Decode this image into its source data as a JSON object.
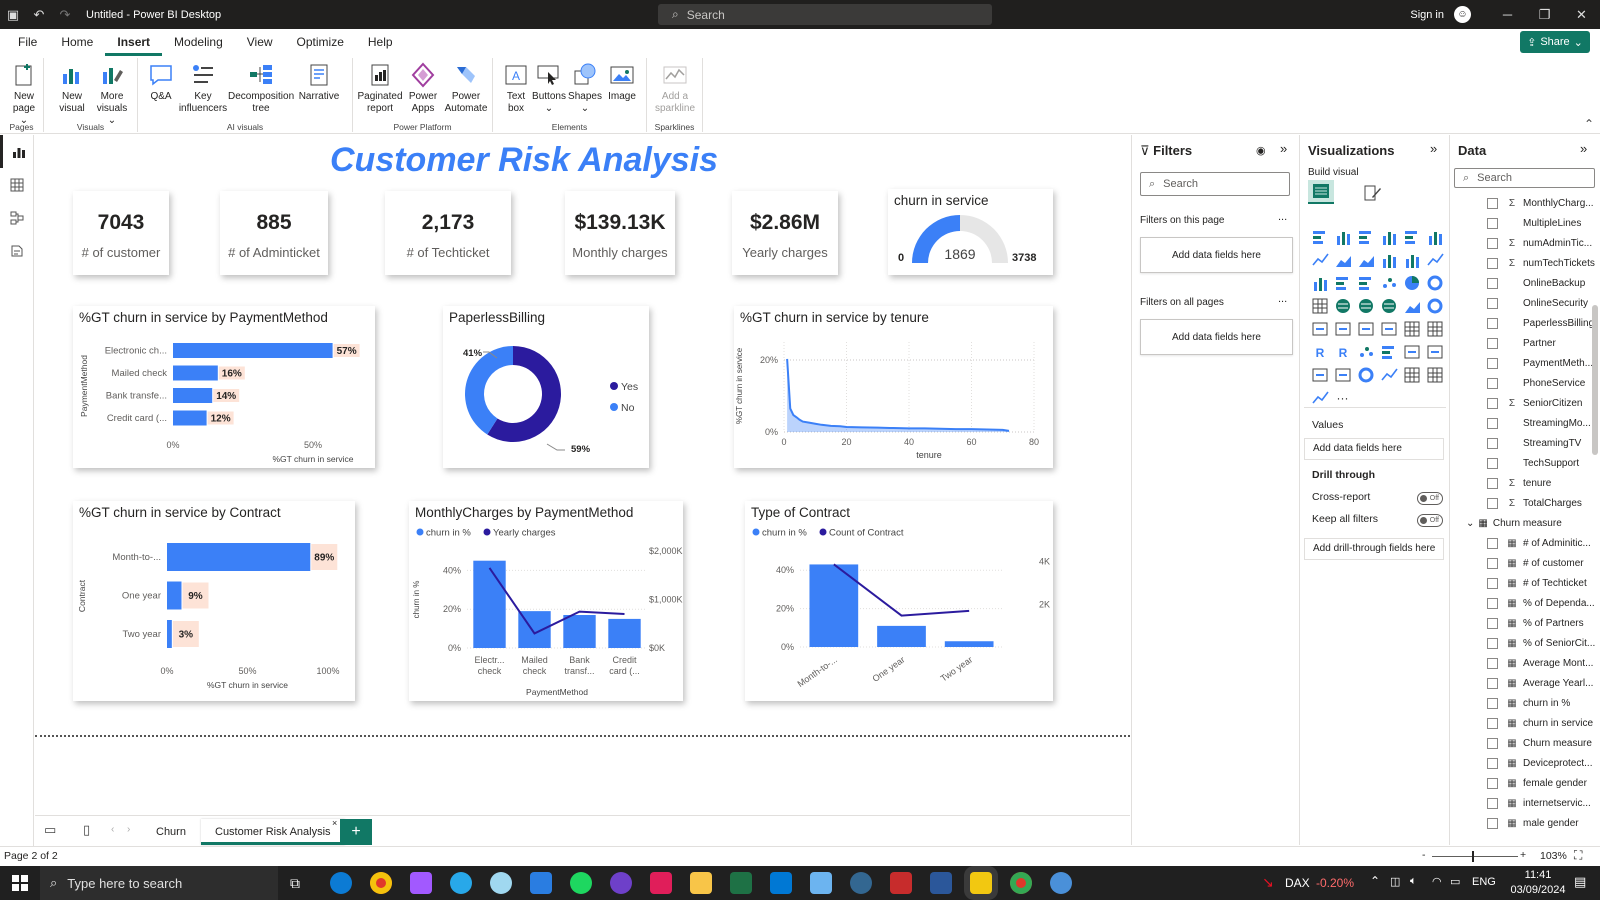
{
  "window": {
    "title": "Untitled - Power BI Desktop",
    "search_placeholder": "Search",
    "sign_in": "Sign in"
  },
  "menu": {
    "items": [
      "File",
      "Home",
      "Insert",
      "Modeling",
      "View",
      "Optimize",
      "Help"
    ],
    "active": "Insert",
    "share": "Share"
  },
  "ribbon": {
    "groups": [
      {
        "label": "Pages",
        "buttons": [
          {
            "label": "New page",
            "sub": "⌄"
          }
        ]
      },
      {
        "label": "Visuals",
        "buttons": [
          {
            "label": "New visual"
          },
          {
            "label": "More visuals",
            "sub": "⌄"
          }
        ]
      },
      {
        "label": "AI visuals",
        "buttons": [
          {
            "label": "Q&A"
          },
          {
            "label": "Key influencers"
          },
          {
            "label": "Decomposition tree"
          },
          {
            "label": "Narrative"
          }
        ]
      },
      {
        "label": "Power Platform",
        "buttons": [
          {
            "label": "Paginated report"
          },
          {
            "label": "Power Apps"
          },
          {
            "label": "Power Automate"
          }
        ]
      },
      {
        "label": "Elements",
        "buttons": [
          {
            "label": "Text box"
          },
          {
            "label": "Buttons",
            "sub": "⌄"
          },
          {
            "label": "Shapes",
            "sub": "⌄"
          },
          {
            "label": "Image"
          }
        ]
      },
      {
        "label": "Sparklines",
        "buttons": [
          {
            "label": "Add a sparkline"
          }
        ]
      }
    ]
  },
  "report": {
    "title": "Customer Risk Analysis",
    "kpis": [
      {
        "value": "7043",
        "label": "# of customer"
      },
      {
        "value": "885",
        "label": "# of Adminticket"
      },
      {
        "value": "2,173",
        "label": "# of Techticket"
      },
      {
        "value": "$139.13K",
        "label": "Monthly charges"
      },
      {
        "value": "$2.86M",
        "label": "Yearly charges"
      }
    ],
    "gauge": {
      "title": "churn in service",
      "min_label": "0",
      "value_label": "1869",
      "max_label": "3738"
    },
    "visual_titles": {
      "payment": "%GT churn in service by PaymentMethod",
      "paperless": "PaperlessBilling",
      "tenure": "%GT churn in service by tenure",
      "contract": "%GT churn in service by Contract",
      "monthly": "MonthlyCharges by PaymentMethod",
      "typecontract": "Type of Contract"
    }
  },
  "chart_data": [
    {
      "type": "gauge",
      "title": "churn in service",
      "value": 1869,
      "min": 0,
      "max": 3738
    },
    {
      "type": "bar",
      "title": "%GT churn in service by PaymentMethod",
      "categories": [
        "Electronic ch...",
        "Mailed check",
        "Bank transfe...",
        "Credit card (..."
      ],
      "values": [
        57,
        16,
        14,
        12
      ],
      "data_labels": [
        "57%",
        "16%",
        "14%",
        "12%"
      ],
      "xlabel": "%GT churn in service",
      "ylabel": "PaymentMethod",
      "x_ticks": [
        "0%",
        "50%"
      ],
      "xlim": [
        0,
        100
      ]
    },
    {
      "type": "pie",
      "title": "PaperlessBilling",
      "categories": [
        "Yes",
        "No"
      ],
      "values": [
        59,
        41
      ],
      "data_labels": [
        "59%",
        "41%"
      ],
      "colors": [
        "#2b1b9e",
        "#3b80f7"
      ]
    },
    {
      "type": "area",
      "title": "%GT churn in service by tenure",
      "xlabel": "tenure",
      "ylabel": "%GT churn in service",
      "x_ticks": [
        "0",
        "20",
        "40",
        "60",
        "80"
      ],
      "y_ticks": [
        "0%",
        "20%"
      ],
      "xlim": [
        0,
        80
      ],
      "ylim": [
        0,
        25
      ],
      "x": [
        1,
        2,
        3,
        4,
        5,
        6,
        8,
        10,
        12,
        15,
        18,
        20,
        25,
        30,
        35,
        40,
        45,
        50,
        55,
        60,
        65,
        70,
        72
      ],
      "y": [
        20.3,
        6.5,
        4.7,
        4.1,
        3.4,
        2.9,
        2.6,
        2.3,
        2.0,
        1.7,
        1.6,
        1.4,
        1.3,
        1.2,
        1.1,
        1.0,
        1.0,
        0.9,
        0.8,
        0.8,
        0.7,
        0.6,
        0.3
      ]
    },
    {
      "type": "bar",
      "title": "%GT churn in service by Contract",
      "categories": [
        "Month-to-...",
        "One year",
        "Two year"
      ],
      "values": [
        89,
        9,
        3
      ],
      "data_labels": [
        "89%",
        "9%",
        "3%"
      ],
      "xlabel": "%GT churn in service",
      "ylabel": "Contract",
      "x_ticks": [
        "0%",
        "50%",
        "100%"
      ],
      "xlim": [
        0,
        100
      ]
    },
    {
      "type": "bar",
      "title": "MonthlyCharges by PaymentMethod",
      "categories": [
        "Electr... check",
        "Mailed check",
        "Bank transf...",
        "Credit card (..."
      ],
      "xlabel": "PaymentMethod",
      "ylabel": "churn in %",
      "y_ticks": [
        "0%",
        "20%",
        "40%"
      ],
      "y2_ticks": [
        "$0K",
        "$1,000K",
        "$2,000K"
      ],
      "ylim": [
        0,
        50
      ],
      "y2lim": [
        0,
        2000
      ],
      "series": [
        {
          "name": "churn in %",
          "values": [
            45,
            19,
            17,
            15
          ],
          "color": "#3b80f7"
        },
        {
          "name": "Yearly charges",
          "values": [
            1650,
            300,
            750,
            700
          ],
          "color": "#2b1b9e"
        }
      ]
    },
    {
      "type": "bar",
      "title": "Type of Contract",
      "categories": [
        "Month-to-...",
        "One year",
        "Two year"
      ],
      "y_ticks": [
        "0%",
        "20%",
        "40%"
      ],
      "y2_ticks": [
        "2K",
        "4K"
      ],
      "ylim": [
        0,
        50
      ],
      "y2lim": [
        0,
        4500
      ],
      "series": [
        {
          "name": "churn in %",
          "values": [
            43,
            11,
            3
          ],
          "color": "#3b80f7"
        },
        {
          "name": "Count of Contract",
          "values": [
            3875,
            1473,
            1695
          ],
          "color": "#2b1b9e"
        }
      ]
    }
  ],
  "pages": {
    "tabs": [
      "Churn",
      "Customer Risk Analysis"
    ],
    "active": "Customer Risk Analysis",
    "add": "+"
  },
  "status": {
    "page": "Page 2 of 2",
    "zoom_minus": "-",
    "zoom_plus": "+",
    "zoom": "103%"
  },
  "filters": {
    "title": "Filters",
    "search_placeholder": "Search",
    "on_page": "Filters on this page",
    "on_all": "Filters on all pages",
    "add_fields": "Add data fields here",
    "more": "..."
  },
  "viz": {
    "title": "Visualizations",
    "build": "Build visual",
    "values": "Values",
    "add_fields": "Add data fields here",
    "drill": "Drill through",
    "cross_report": "Cross-report",
    "keep_filters": "Keep all filters",
    "toggle_off": "Off",
    "add_drill": "Add drill-through fields here",
    "more": "..."
  },
  "data": {
    "title": "Data",
    "search_placeholder": "Search",
    "fields": [
      {
        "name": "MonthlyCharg...",
        "icon": "Σ"
      },
      {
        "name": "MultipleLines",
        "icon": ""
      },
      {
        "name": "numAdminTic...",
        "icon": "Σ"
      },
      {
        "name": "numTechTickets",
        "icon": "Σ"
      },
      {
        "name": "OnlineBackup",
        "icon": ""
      },
      {
        "name": "OnlineSecurity",
        "icon": ""
      },
      {
        "name": "PaperlessBilling",
        "icon": ""
      },
      {
        "name": "Partner",
        "icon": ""
      },
      {
        "name": "PaymentMeth...",
        "icon": ""
      },
      {
        "name": "PhoneService",
        "icon": ""
      },
      {
        "name": "SeniorCitizen",
        "icon": "Σ"
      },
      {
        "name": "StreamingMo...",
        "icon": ""
      },
      {
        "name": "StreamingTV",
        "icon": ""
      },
      {
        "name": "TechSupport",
        "icon": ""
      },
      {
        "name": "tenure",
        "icon": "Σ"
      },
      {
        "name": "TotalCharges",
        "icon": "Σ"
      }
    ],
    "table": "Churn measure",
    "measures": [
      "# of Adminitic...",
      "# of customer",
      "# of Techticket",
      "% of Dependa...",
      "% of Partners",
      "% of SeniorCit...",
      "Average Mont...",
      "Average Yearl...",
      "churn in %",
      "churn in service",
      "Churn measure",
      "Deviceprotect...",
      "female gender",
      "internetservic...",
      "male gender"
    ]
  },
  "taskbar": {
    "search_placeholder": "Type here to search",
    "ticker": "DAX",
    "change": "-0.20%",
    "lang": "ENG",
    "time": "11:41",
    "date": "03/09/2024"
  }
}
